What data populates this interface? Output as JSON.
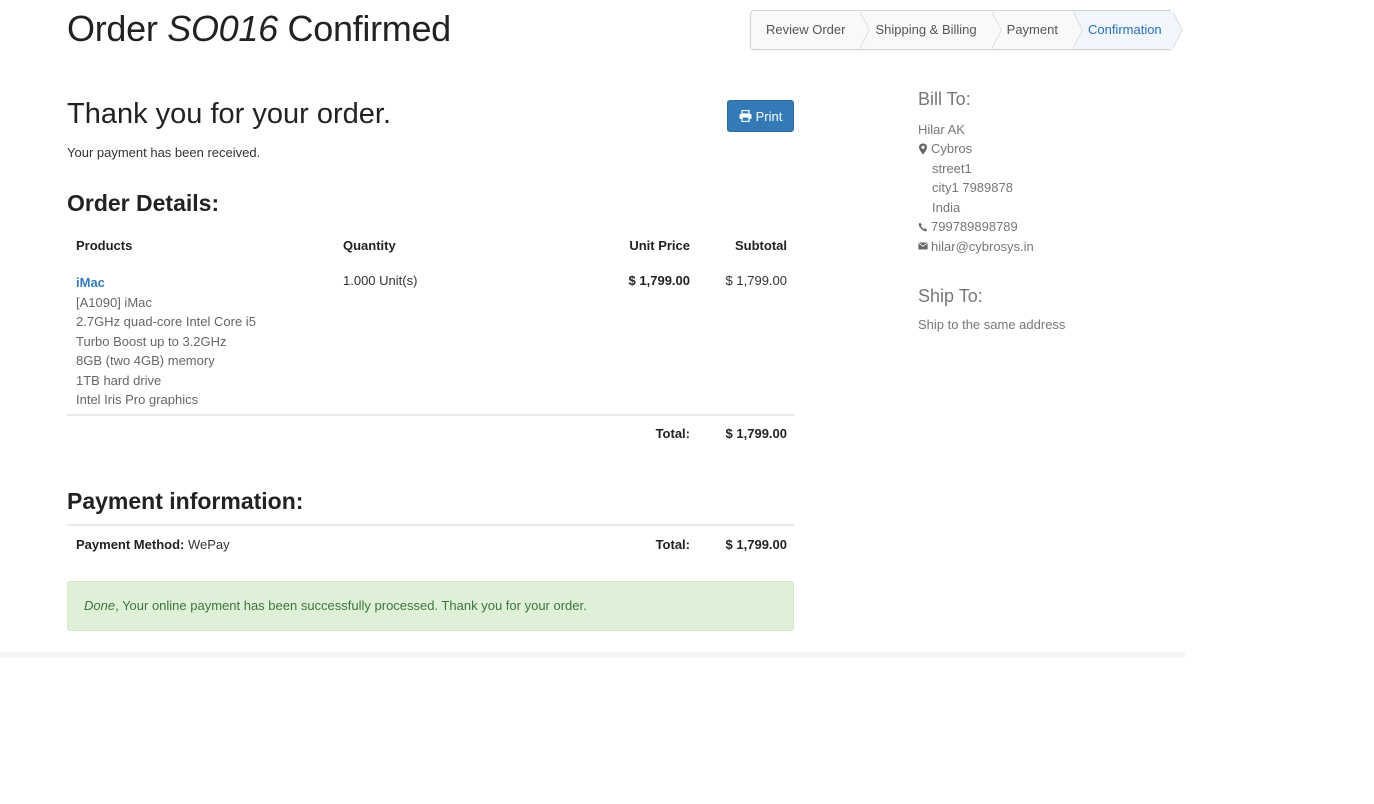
{
  "header": {
    "title_prefix": "Order",
    "order_ref": "SO016",
    "title_suffix": "Confirmed"
  },
  "wizard": {
    "steps": [
      {
        "label": "Review Order"
      },
      {
        "label": "Shipping & Billing"
      },
      {
        "label": "Payment"
      },
      {
        "label": "Confirmation"
      }
    ],
    "active_step": "Confirmation"
  },
  "thanks": {
    "heading": "Thank you for your order.",
    "message": "Your payment has been received.",
    "print_label": "Print"
  },
  "order_details": {
    "title": "Order Details:",
    "columns": {
      "products": "Products",
      "quantity": "Quantity",
      "unit_price": "Unit Price",
      "subtotal": "Subtotal"
    },
    "line": {
      "product_name": "iMac",
      "description": [
        "[A1090] iMac",
        "2.7GHz quad-core Intel Core i5",
        "Turbo Boost up to 3.2GHz",
        "8GB (two 4GB) memory",
        "1TB hard drive",
        "Intel Iris Pro graphics"
      ],
      "quantity": "1.000 Unit(s)",
      "unit_price": "$ 1,799.00",
      "subtotal": "$ 1,799.00"
    },
    "total_label": "Total:",
    "total_value": "$ 1,799.00"
  },
  "payment_info": {
    "title": "Payment information:",
    "method_label": "Payment Method:",
    "method_value": "WePay",
    "total_label": "Total:",
    "total_value": "$ 1,799.00"
  },
  "alert": {
    "status": "Done",
    "message": ", Your online payment has been successfully processed. Thank you for your order."
  },
  "bill_to": {
    "title": "Bill To:",
    "name": "Hilar AK",
    "company": "Cybros",
    "street": "street1",
    "city_zip": "city1 7989878",
    "country": "India",
    "phone": "799789898789",
    "email": "hilar@cybrosys.in"
  },
  "ship_to": {
    "title": "Ship To:",
    "text": "Ship to the same address"
  },
  "colors": {
    "primary": "#337ab7",
    "success_bg": "#dff0d8",
    "success_text": "#3c763d",
    "active_step": "#2a6fb5"
  },
  "icons": {
    "print": "print-icon",
    "location": "map-marker-icon",
    "phone": "phone-icon",
    "email": "envelope-icon"
  }
}
